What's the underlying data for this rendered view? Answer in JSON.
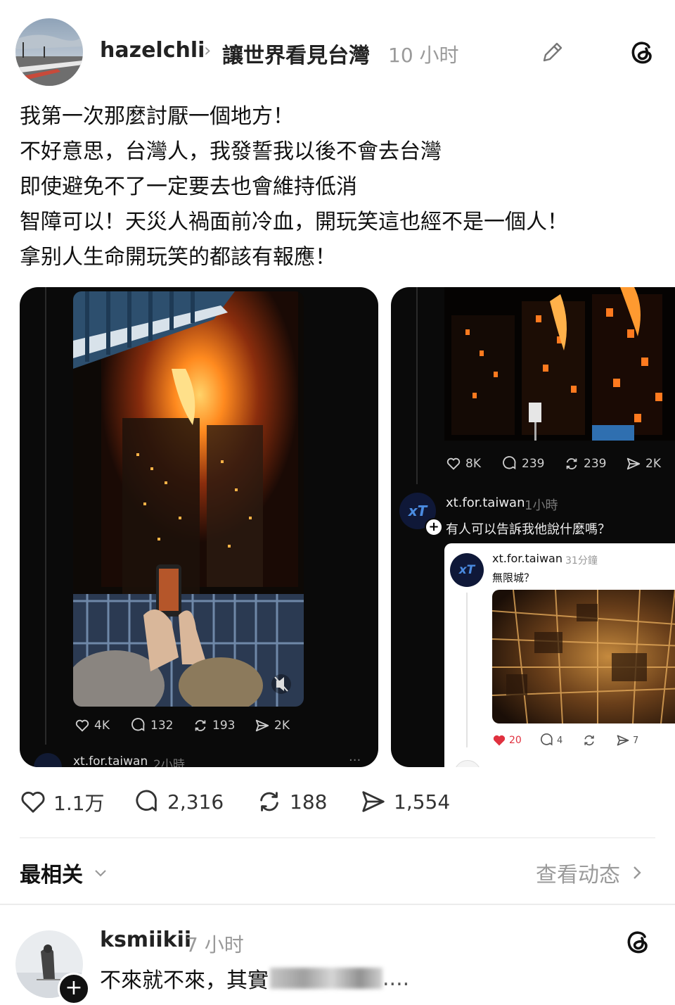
{
  "post": {
    "username": "hazelchli",
    "topic": "讓世界看見台灣",
    "time": "10 小时",
    "lines": [
      "我第一次那麼討厭一個地方！",
      "不好意思，台灣人，我發誓我以後不會去台灣",
      "即使避免不了一定要去也會維持低消",
      "智障可以！天災人禍面前冷血，開玩笑這也經不是一個人！",
      "拿别人生命開玩笑的都該有報應！"
    ],
    "stats": {
      "likes": "1.1万",
      "comments": "2,316",
      "reposts": "188",
      "shares": "1,554"
    }
  },
  "image1": {
    "stats": {
      "likes": "4K",
      "comments": "132",
      "reposts": "193",
      "shares": "2K"
    },
    "footer_user": "xt.for.taiwan",
    "footer_time": "2小時"
  },
  "image2": {
    "stats": {
      "likes": "8K",
      "comments": "239",
      "reposts": "239",
      "shares": "2K"
    },
    "reply_user": "xt.for.taiwan",
    "reply_time": "1小時",
    "reply_text": "有人可以告訴我他說什麼嗎？",
    "avatar_text": "xT",
    "nested": {
      "user": "xt.for.taiwan",
      "time": "31分鐘",
      "text": "無限城？",
      "stats": {
        "likes": "20",
        "comments": "4",
        "shares": "7"
      }
    }
  },
  "sort": {
    "label": "最相关",
    "activity_link": "查看动态"
  },
  "comment": {
    "username": "ksmiikii",
    "time": "7 小时",
    "text": "不來就不來，其實"
  },
  "colors": {
    "like_red": "#e0313f",
    "muted": "#9a9a9a",
    "card_bg": "#0a0a0a"
  }
}
